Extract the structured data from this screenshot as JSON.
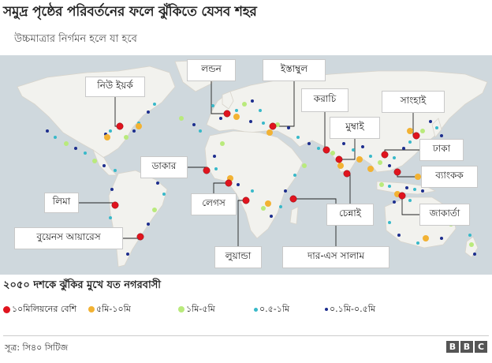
{
  "header": {
    "title": "সমুদ্র পৃষ্ঠের পরিবর্তনের ফলে ঝুঁকিতে যেসব শহর",
    "subtitle": "উচ্চমাত্রার নির্গমন হলে যা হবে"
  },
  "colors": {
    "ocean": "#cfd8dd",
    "land": "#f2f2ee",
    "coast": "#d8d4cb",
    "leader": "#222222",
    "tier_10m_plus": "#e0141e",
    "tier_5m_10m": "#f2b233",
    "tier_1m_5m": "#b9ea7c",
    "tier_05m_1m": "#38b9c9",
    "tier_01m_05m": "#1d2e8e"
  },
  "city_labels": [
    {
      "id": "newyork",
      "text": "নিউ ইয়র্ক"
    },
    {
      "id": "london",
      "text": "লন্ডন"
    },
    {
      "id": "istanbul",
      "text": "ইস্তাম্বুল"
    },
    {
      "id": "karachi",
      "text": "করাচি"
    },
    {
      "id": "shanghai",
      "text": "সাংহাই"
    },
    {
      "id": "mumbai",
      "text": "মুম্বাই"
    },
    {
      "id": "dhaka",
      "text": "ঢাকা"
    },
    {
      "id": "dakar",
      "text": "ডাকার"
    },
    {
      "id": "bangkok",
      "text": "ব্যাংকক"
    },
    {
      "id": "lima",
      "text": "লিমা"
    },
    {
      "id": "lagos",
      "text": "লেগস"
    },
    {
      "id": "chennai",
      "text": "চেন্নাই"
    },
    {
      "id": "jakarta",
      "text": "জাকার্তা"
    },
    {
      "id": "buenosaires",
      "text": "বুয়েনস আয়ারেস"
    },
    {
      "id": "luanda",
      "text": "লুয়ান্ডা"
    },
    {
      "id": "daressalaam",
      "text": "দার-এস সালাম"
    }
  ],
  "legend": {
    "title": "২০৫০ দশকে ঝুঁকির মুখে যত নগরবাসী",
    "items": [
      {
        "label": "১০মিলিয়নের বেশি",
        "tier": "tier_10m_plus"
      },
      {
        "label": "৫মি-১০মি",
        "tier": "tier_5m_10m"
      },
      {
        "label": "১মি-৫মি",
        "tier": "tier_1m_5m"
      },
      {
        "label": "০.৫-১মি",
        "tier": "tier_05m_1m"
      },
      {
        "label": "০.১মি-০.৫মি",
        "tier": "tier_01m_05m"
      }
    ]
  },
  "footer": {
    "source": "সূত্র: সি৪০ সিটিজ",
    "logo": [
      "B",
      "B",
      "C"
    ]
  }
}
